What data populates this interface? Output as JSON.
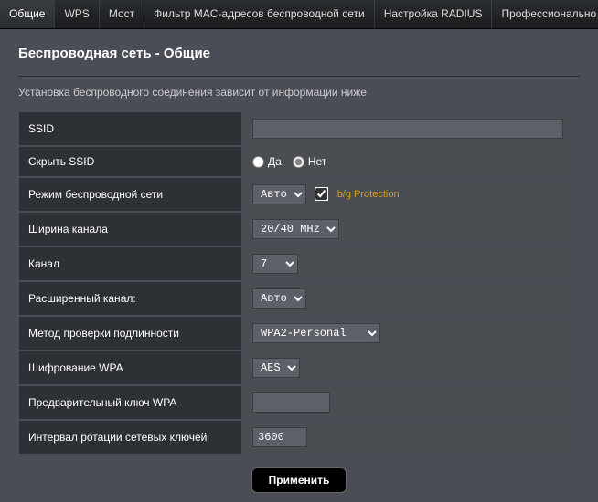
{
  "tabs": {
    "general": "Общие",
    "wps": "WPS",
    "bridge": "Мост",
    "mac_filter": "Фильтр MAC-адресов беспроводной сети",
    "radius": "Настройка RADIUS",
    "professional": "Профессионально"
  },
  "page_title": "Беспроводная сеть - Общие",
  "description": "Установка беспроводного соединения зависит от информации ниже",
  "labels": {
    "ssid": "SSID",
    "hide_ssid": "Скрыть SSID",
    "wireless_mode": "Режим беспроводной сети",
    "channel_width": "Ширина канала",
    "channel": "Канал",
    "ext_channel": "Расширенный канал:",
    "auth_method": "Метод проверки подлинности",
    "wpa_enc": "Шифрование WPA",
    "wpa_psk": "Предварительный ключ WPA",
    "rotation_interval": "Интервал ротации сетевых ключей"
  },
  "values": {
    "ssid": "",
    "hide_ssid_yes": "Да",
    "hide_ssid_no": "Нет",
    "wireless_mode": "Авто",
    "bg_protection": "b/g Protection",
    "channel_width": "20/40 MHz",
    "channel": "7",
    "ext_channel": "Авто",
    "auth_method": "WPA2-Personal",
    "wpa_enc": "AES",
    "wpa_psk": "",
    "rotation_interval": "3600"
  },
  "apply": "Применить"
}
